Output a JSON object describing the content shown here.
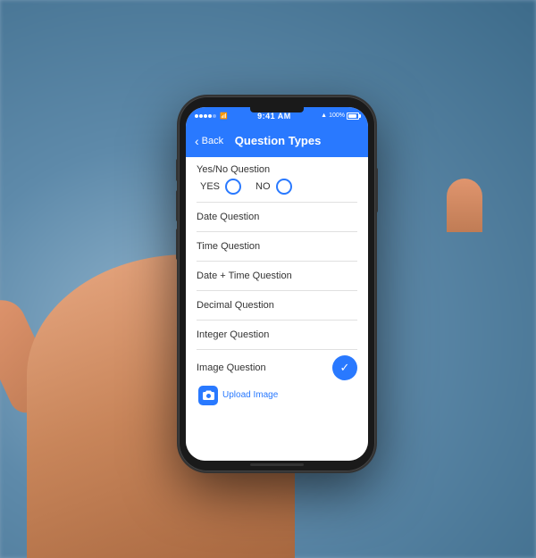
{
  "background": {
    "color": "#7a9bb5"
  },
  "status_bar": {
    "time": "9:41 AM",
    "battery": "100%",
    "carrier": "●●●●●"
  },
  "nav_bar": {
    "back_label": "Back",
    "title": "Question Types"
  },
  "questions": [
    {
      "id": "yes_no",
      "label": "Yes/No Question",
      "type": "yes_no",
      "options": [
        "YES",
        "NO"
      ]
    },
    {
      "id": "date",
      "label": "Date Question",
      "type": "simple"
    },
    {
      "id": "time",
      "label": "Time Question",
      "type": "simple"
    },
    {
      "id": "date_time",
      "label": "Date + Time Question",
      "type": "simple"
    },
    {
      "id": "decimal",
      "label": "Decimal Question",
      "type": "simple"
    },
    {
      "id": "integer",
      "label": "Integer Question",
      "type": "simple"
    },
    {
      "id": "image",
      "label": "Image Question",
      "type": "image",
      "selected": true,
      "upload_label": "Upload Image"
    }
  ],
  "colors": {
    "primary": "#2979FF",
    "text": "#333333",
    "divider": "#e0e0e0",
    "background": "#ffffff"
  }
}
